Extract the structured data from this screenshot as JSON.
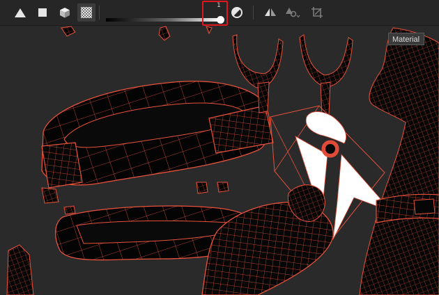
{
  "toolbar": {
    "buttons": [
      {
        "name": "flat-shading-icon",
        "active": false
      },
      {
        "name": "solid-square-icon",
        "active": false
      },
      {
        "name": "cube-icon",
        "active": false
      },
      {
        "name": "checker-wireframe-icon",
        "active": true
      }
    ],
    "wireframe_opacity_slider": {
      "value_label": "1",
      "value": 1.0,
      "min": 0,
      "max": 1
    },
    "right_buttons": [
      "contrast-circle-icon",
      "symmetry-icon",
      "transform-options-icon",
      "crop-transform-icon"
    ]
  },
  "tooltip": {
    "text": "Material"
  },
  "colors": {
    "wire": "#e8523c",
    "toolbar_bg": "#262626",
    "viewport_bg": "#2a2a2a",
    "highlight": "#e2161f"
  }
}
